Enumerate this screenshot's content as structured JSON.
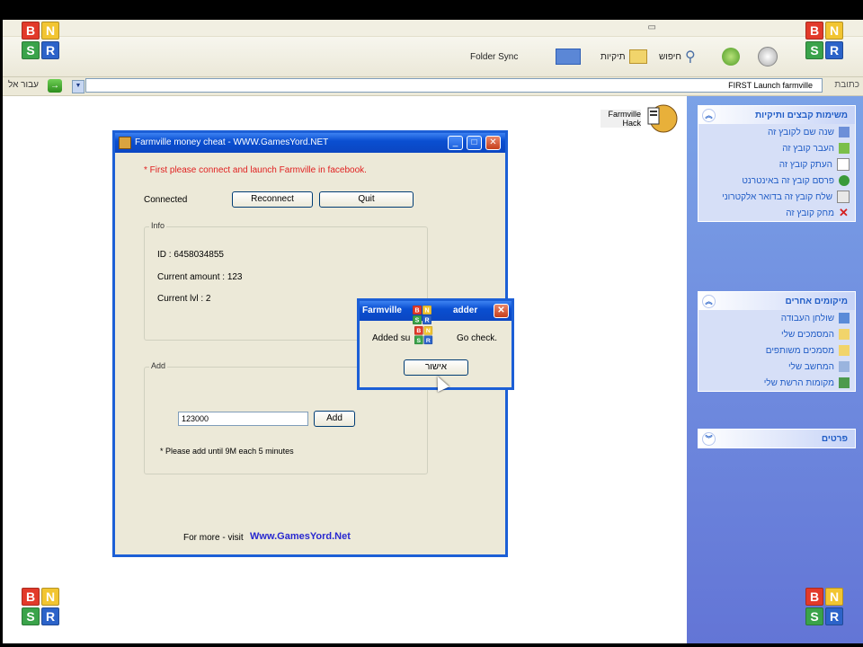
{
  "toolbar": {
    "folder_sync": "Folder Sync",
    "folders_label": "תיקיות",
    "search_label": "חיפוש"
  },
  "address": {
    "go_label": "עבור אל",
    "path": "FIRST Launch farmville",
    "label": "כתובת"
  },
  "desktop_icon": {
    "label": "Farmville Hack"
  },
  "taskpane": {
    "tasks_header": "משימות קבצים ותיקיות",
    "tasks": [
      "שנה שם לקובץ זה",
      "העבר קובץ זה",
      "העתק קובץ זה",
      "פרסם קובץ זה באינטרנט",
      "שלח קובץ זה בדואר אלקטרוני",
      "מחק קובץ זה"
    ],
    "places_header": "מיקומים אחרים",
    "places": [
      "שולחן העבודה",
      "המסמכים שלי",
      "מסמכים משותפים",
      "המחשב שלי",
      "מקומות הרשת שלי"
    ],
    "details_header": "פרטים"
  },
  "main_window": {
    "title": "Farmville money cheat - WWW.GamesYord.NET",
    "red_note": "* First please connect and launch Farmville in facebook.",
    "connected_label": "Connected",
    "reconnect_button": "Reconnect",
    "quit_button": "Quit",
    "info_group": "Info",
    "id_line": "ID : 6458034855",
    "current_amount_line": "Current amount : 123",
    "current_lvl_line": "Current lvl : 2",
    "add_group": "Add",
    "amount_value": "123000",
    "add_button": "Add",
    "add_note": "* Please add until 9M each 5 minutes",
    "for_more": "For more - visit",
    "website": "Www.GamesYord.Net"
  },
  "popup": {
    "title_left": "Farmville",
    "title_right": "adder",
    "message_left": "Added su",
    "message_right": "Go check.",
    "ok_button": "אישור"
  },
  "logo": {
    "letters": [
      "B",
      "N",
      "S",
      "R"
    ]
  }
}
